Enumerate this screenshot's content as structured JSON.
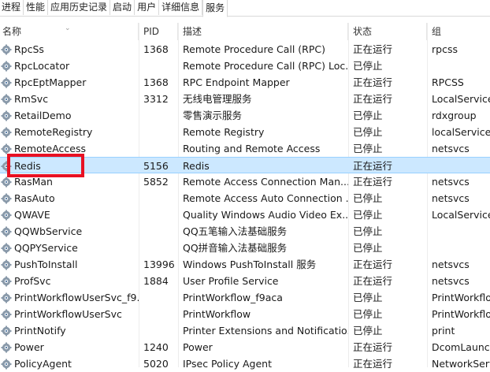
{
  "tabs": [
    "进程",
    "性能",
    "应用历史记录",
    "启动",
    "用户",
    "详细信息",
    "服务"
  ],
  "active_tab": 6,
  "columns": {
    "name": "名称",
    "pid": "PID",
    "desc": "描述",
    "status": "状态",
    "group": "组"
  },
  "services": [
    {
      "name": "RpcSs",
      "pid": "1368",
      "desc": "Remote Procedure Call (RPC)",
      "status": "正在运行",
      "group": "rpcss"
    },
    {
      "name": "RpcLocator",
      "pid": "",
      "desc": "Remote Procedure Call (RPC) Loc...",
      "status": "已停止",
      "group": ""
    },
    {
      "name": "RpcEptMapper",
      "pid": "1368",
      "desc": "RPC Endpoint Mapper",
      "status": "正在运行",
      "group": "RPCSS"
    },
    {
      "name": "RmSvc",
      "pid": "3312",
      "desc": "无线电管理服务",
      "status": "正在运行",
      "group": "LocalService..."
    },
    {
      "name": "RetailDemo",
      "pid": "",
      "desc": "零售演示服务",
      "status": "已停止",
      "group": "rdxgroup"
    },
    {
      "name": "RemoteRegistry",
      "pid": "",
      "desc": "Remote Registry",
      "status": "已停止",
      "group": "localService"
    },
    {
      "name": "RemoteAccess",
      "pid": "",
      "desc": "Routing and Remote Access",
      "status": "已停止",
      "group": "netsvcs"
    },
    {
      "name": "Redis",
      "pid": "5156",
      "desc": "Redis",
      "status": "正在运行",
      "group": ""
    },
    {
      "name": "RasMan",
      "pid": "5852",
      "desc": "Remote Access Connection Man...",
      "status": "正在运行",
      "group": "netsvcs"
    },
    {
      "name": "RasAuto",
      "pid": "",
      "desc": "Remote Access Auto Connection ...",
      "status": "已停止",
      "group": "netsvcs"
    },
    {
      "name": "QWAVE",
      "pid": "",
      "desc": "Quality Windows Audio Video Ex...",
      "status": "已停止",
      "group": "LocalService..."
    },
    {
      "name": "QQWbService",
      "pid": "",
      "desc": "QQ五笔输入法基础服务",
      "status": "已停止",
      "group": ""
    },
    {
      "name": "QQPYService",
      "pid": "",
      "desc": "QQ拼音输入法基础服务",
      "status": "已停止",
      "group": ""
    },
    {
      "name": "PushToInstall",
      "pid": "13996",
      "desc": "Windows PushToInstall 服务",
      "status": "正在运行",
      "group": "netsvcs"
    },
    {
      "name": "ProfSvc",
      "pid": "1884",
      "desc": "User Profile Service",
      "status": "正在运行",
      "group": "netsvcs"
    },
    {
      "name": "PrintWorkflowUserSvc_f9...",
      "pid": "",
      "desc": "PrintWorkflow_f9aca",
      "status": "已停止",
      "group": "PrintWorkflow"
    },
    {
      "name": "PrintWorkflowUserSvc",
      "pid": "",
      "desc": "PrintWorkflow",
      "status": "已停止",
      "group": "PrintWorkflow"
    },
    {
      "name": "PrintNotify",
      "pid": "",
      "desc": "Printer Extensions and Notificatio...",
      "status": "已停止",
      "group": "print"
    },
    {
      "name": "Power",
      "pid": "1240",
      "desc": "Power",
      "status": "正在运行",
      "group": "DcomLaunch"
    },
    {
      "name": "PolicyAgent",
      "pid": "5020",
      "desc": "IPsec Policy Agent",
      "status": "正在运行",
      "group": "NetworkServ..."
    }
  ],
  "selected_index": 7
}
